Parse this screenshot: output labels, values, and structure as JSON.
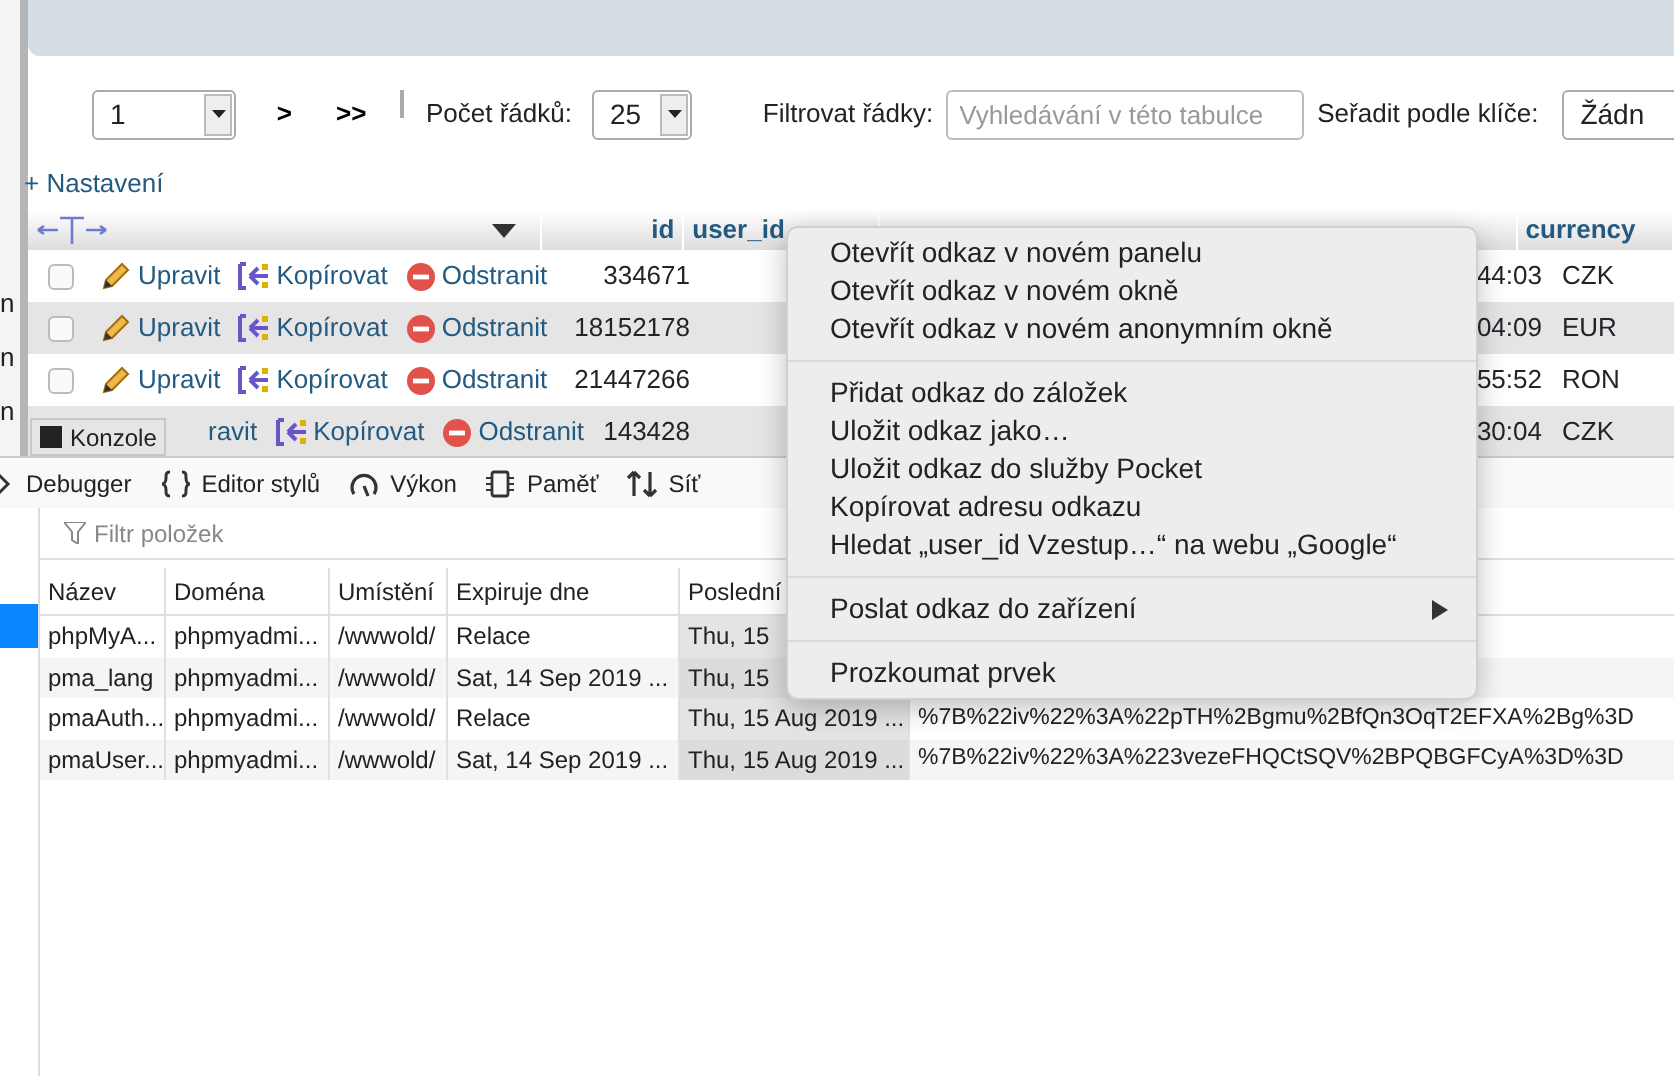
{
  "side_strip": [
    "n",
    "n",
    "n"
  ],
  "pagination": {
    "page": "1",
    "next": ">",
    "last": ">>",
    "rows_label": "Počet řádků:",
    "rows_value": "25",
    "filter_label": "Filtrovat řádky:",
    "filter_placeholder": "Vyhledávání v této tabulce",
    "sort_label": "Seřadit podle klíče:",
    "sort_value": "Žádn"
  },
  "settings_link": "+ Nastavení",
  "table": {
    "columns": [
      "id",
      "user_id",
      "currency"
    ],
    "rows": [
      {
        "kind": "full",
        "checked": false,
        "edit": "Upravit",
        "copy": "Kopírovat",
        "delete": "Odstranit",
        "id": "334671",
        "updated_at": "44:03",
        "currency": "CZK"
      },
      {
        "kind": "full",
        "checked": false,
        "edit": "Upravit",
        "copy": "Kopírovat",
        "delete": "Odstranit",
        "id": "18152178",
        "updated_at": "04:09",
        "currency": "EUR"
      },
      {
        "kind": "full",
        "checked": false,
        "edit": "Upravit",
        "copy": "Kopírovat",
        "delete": "Odstranit",
        "id": "21447266",
        "updated_at": "55:52",
        "currency": "RON"
      },
      {
        "kind": "partial",
        "edit": "ravit",
        "copy": "Kopírovat",
        "delete": "Odstranit",
        "id": "143428",
        "updated_at": "30:04",
        "currency": "CZK"
      }
    ]
  },
  "devtools": {
    "console_button": "Konzole",
    "tools": [
      {
        "kind": "debugger",
        "label": "Debugger"
      },
      {
        "kind": "style",
        "label": "Editor stylů"
      },
      {
        "kind": "performance",
        "label": "Výkon"
      },
      {
        "kind": "memory",
        "label": "Paměť"
      },
      {
        "kind": "network",
        "label": "Síť"
      }
    ],
    "storage": {
      "filter_placeholder": "Filtr položek",
      "columns": [
        "Název",
        "Doména",
        "Umístění",
        "Expiruje dne",
        "Poslední"
      ],
      "rows": [
        {
          "cells": [
            "phpMyA...",
            "phpmyadmi...",
            "/wwwold/",
            "Relace",
            "Thu, 15"
          ]
        },
        {
          "cells": [
            "pma_lang",
            "phpmyadmi...",
            "/wwwold/",
            "Sat, 14 Sep 2019 ...",
            "Thu, 15"
          ]
        },
        {
          "cells": [
            "pmaAuth...",
            "phpmyadmi...",
            "/wwwold/",
            "Relace",
            "Thu, 15 Aug 2019 ...",
            "%7B%22iv%22%3A%22pTH%2Bgmu%2BfQn3OqT2EFXA%2Bg%3D"
          ]
        },
        {
          "cells": [
            "pmaUser...",
            "phpmyadmi...",
            "/wwwold/",
            "Sat, 14 Sep 2019 ...",
            "Thu, 15 Aug 2019 ...",
            "%7B%22iv%22%3A%223vezeFHQCtSQV%2BPQBGFCyA%3D%3D"
          ]
        }
      ]
    }
  },
  "context_menu": [
    {
      "kind": "item",
      "label": "Otevřít odkaz v novém panelu"
    },
    {
      "kind": "item",
      "label": "Otevřít odkaz v novém okně"
    },
    {
      "kind": "item",
      "label": "Otevřít odkaz v novém anonymním okně"
    },
    {
      "kind": "separator"
    },
    {
      "kind": "item",
      "label": "Přidat odkaz do záložek"
    },
    {
      "kind": "item",
      "label": "Uložit odkaz jako…"
    },
    {
      "kind": "item",
      "label": "Uložit odkaz do služby Pocket"
    },
    {
      "kind": "item",
      "label": "Kopírovat adresu odkazu"
    },
    {
      "kind": "item",
      "label": "Hledat „user_id Vzestup…“ na webu „Google“"
    },
    {
      "kind": "separator"
    },
    {
      "kind": "submenu",
      "label": "Poslat odkaz do zařízení"
    },
    {
      "kind": "separator"
    },
    {
      "kind": "item",
      "label": "Prozkoumat prvek"
    }
  ]
}
